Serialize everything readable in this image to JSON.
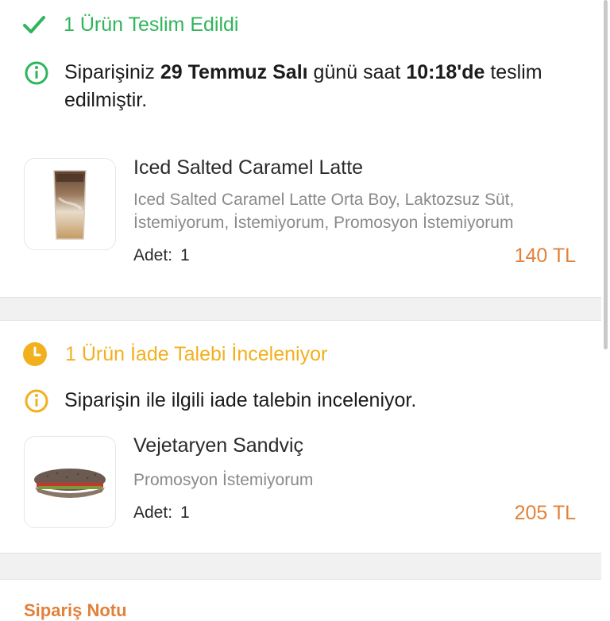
{
  "colors": {
    "delivered": "#2fb55a",
    "pending": "#f2b01e",
    "price": "#e2813a",
    "muted": "#8a8a8a"
  },
  "delivered_section": {
    "status_icon": "check-icon",
    "status": "1 Ürün Teslim Edildi",
    "info_icon": "info-circle-icon",
    "info_prefix": "Siparişiniz ",
    "info_date": "29 Temmuz Salı",
    "info_mid": " günü saat ",
    "info_time": "10:18'de",
    "info_suffix": " teslim edilmiştir.",
    "product": {
      "name": "Iced Salted Caramel Latte",
      "description": "Iced Salted Caramel Latte Orta Boy, Laktozsuz Süt, İstemiyorum, İstemiyorum, Promosyon İstemiyorum",
      "qty_label": "Adet:",
      "qty": "1",
      "price": "140 TL"
    }
  },
  "refund_section": {
    "status_icon": "clock-icon",
    "status": "1 Ürün İade Talebi İnceleniyor",
    "info_icon": "info-circle-icon",
    "info": "Siparişin ile ilgili iade talebin inceleniyor.",
    "product": {
      "name": "Vejetaryen Sandviç",
      "description": "Promosyon İstemiyorum",
      "qty_label": "Adet:",
      "qty": "1",
      "price": "205 TL"
    }
  },
  "footer": {
    "partial_title": "Sipariş Notu"
  }
}
